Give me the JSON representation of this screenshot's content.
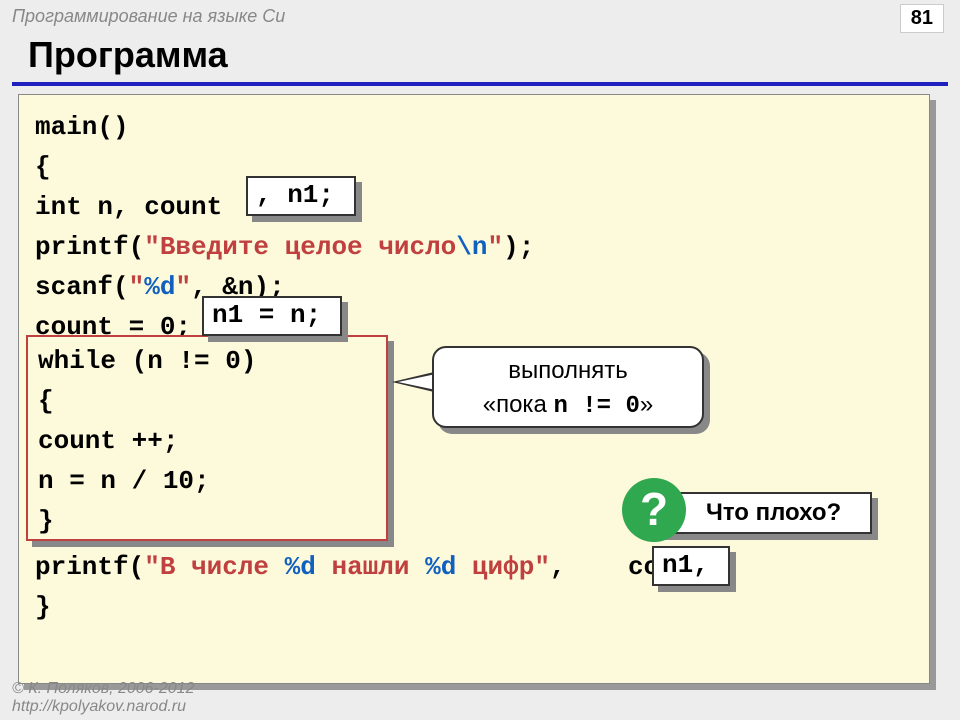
{
  "header": "Программирование на языке Си",
  "page_number": "81",
  "title": "Программа",
  "code": {
    "l1": "main()",
    "l2": "{",
    "l3a": "int",
    "l3b": " n, count",
    "l4a": "printf(",
    "l4b": "\"Введите целое число",
    "l4c": "\\n",
    "l4d": "\"",
    "l4e": ");",
    "l5a": "scanf(",
    "l5b": "\"",
    "l5c": "%d",
    "l5d": "\"",
    "l5e": ", &n);",
    "l6": "count = 0;",
    "l8a": "printf(",
    "l8b": "\"В числе ",
    "l8c": "%d",
    "l8d": " нашли ",
    "l8e": "%d",
    "l8f": " цифр\"",
    "l8g": ",",
    "l8h": " count);",
    "l9": "}"
  },
  "while_block": {
    "l1a": "while",
    "l1b": " (n != 0)",
    "l2": "  {",
    "l3": "  count ++;",
    "l4": "  n = n / 10;",
    "l5": "  }"
  },
  "overlays": {
    "n1_decl": ", n1;",
    "n1_assign": "n1 = n;",
    "n1_arg": "n1,"
  },
  "callout": {
    "line1": "выполнять",
    "line2a": "«пока ",
    "line2b": "n != 0",
    "line2c": "»"
  },
  "question": {
    "mark": "?",
    "text": "Что плохо?"
  },
  "footer": {
    "l1": "© К. Поляков, 2006-2012",
    "l2": "http://kpolyakov.narod.ru"
  }
}
